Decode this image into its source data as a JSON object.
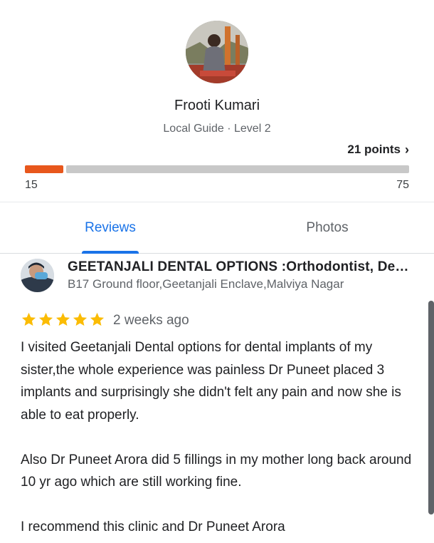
{
  "profile": {
    "name": "Frooti Kumari",
    "subtitle": "Local Guide · Level 2",
    "points_label": "21 points",
    "level_min": "15",
    "level_max": "75",
    "progress_fraction": 0.1,
    "accent_color": "#e8571c"
  },
  "tabs": [
    {
      "label": "Reviews",
      "active": true
    },
    {
      "label": "Photos",
      "active": false
    }
  ],
  "review": {
    "place_name": "GEETANJALI DENTAL OPTIONS :Orthodontist, Dental Implants",
    "place_address": "B17 Ground floor,Geetanjali Enclave,Malviya Nagar",
    "rating": 5,
    "star_color": "#fbbc04",
    "date": "2 weeks ago",
    "text": "I visited Geetanjali Dental options for dental implants of my sister,the whole experience was painless Dr Puneet placed 3 implants and surprisingly she didn't felt any pain and now she is able to eat properly.\n\nAlso Dr Puneet Arora did 5 fillings in my mother long back around 10 yr ago which are still working fine.\n\nI recommend this clinic and Dr Puneet Arora"
  }
}
